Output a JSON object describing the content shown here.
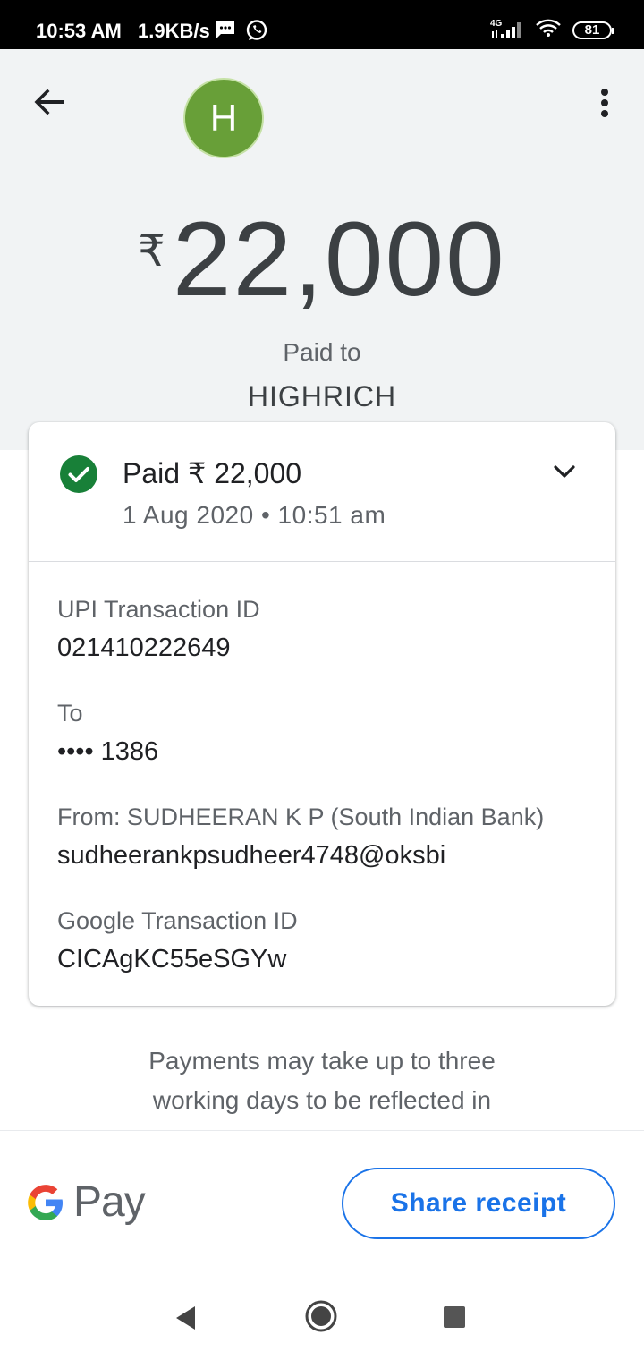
{
  "status_bar": {
    "time": "10:53 AM",
    "network_speed": "1.9KB/s",
    "network_type": "4G",
    "battery": "81",
    "icons": [
      "message-icon",
      "whatsapp-icon",
      "signal-icon",
      "wifi-icon",
      "battery-icon"
    ]
  },
  "header": {
    "avatar_initial": "H",
    "avatar_color": "#689f38",
    "currency_symbol": "₹",
    "amount": "22,000",
    "paid_to_label": "Paid to",
    "payee_name": "HIGHRICH",
    "icons": [
      "back-arrow-icon",
      "more-vert-icon"
    ]
  },
  "transaction": {
    "status_title": "Paid ₹ 22,000",
    "date_time": "1 Aug 2020 • 10:51 am",
    "status_color": "#188038",
    "details": [
      {
        "label": "UPI Transaction ID",
        "value": "021410222649"
      },
      {
        "label": "To",
        "value": "•••• 1386"
      },
      {
        "label": "From: SUDHEERAN K P (South Indian Bank)",
        "value": "sudheerankpsudheer4748@oksbi"
      },
      {
        "label": "Google Transaction ID",
        "value": "CICAgKC55eSGYw"
      }
    ]
  },
  "note": {
    "line1": "Payments may take up to three",
    "line2": "working days to be reflected in"
  },
  "footer": {
    "brand": "Pay",
    "share_label": "Share receipt",
    "accent_color": "#1a73e8"
  }
}
